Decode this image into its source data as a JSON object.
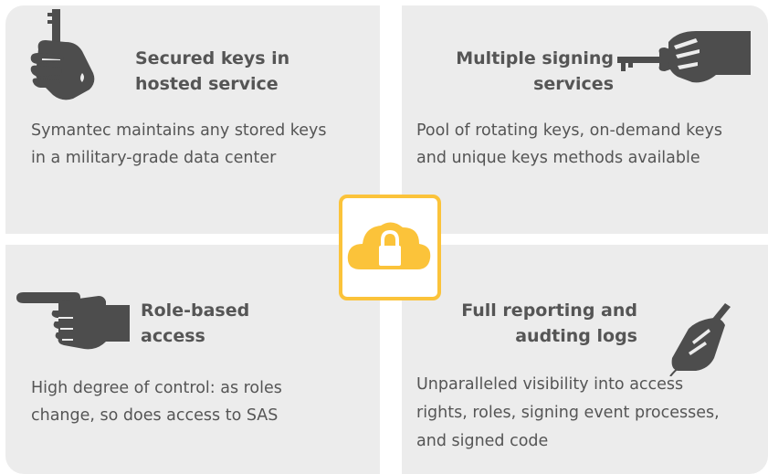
{
  "features": {
    "secured_keys": {
      "title_line1": "Secured keys in",
      "title_line2": "hosted service",
      "desc_line1": "Symantec maintains any stored keys",
      "desc_line2": "in a military-grade data center",
      "icon": "hand-holding-key-icon"
    },
    "signing_services": {
      "title_line1": "Multiple signing",
      "title_line2": "services",
      "desc_line1": "Pool of rotating keys, on-demand keys",
      "desc_line2": "and unique keys methods available",
      "icon": "hand-holding-key-horizontal-icon"
    },
    "role_access": {
      "title_line1": "Role-based",
      "title_line2": "access",
      "desc_line1": "High degree of control: as roles",
      "desc_line2": "change, so does access to SAS",
      "icon": "pointing-hand-icon"
    },
    "reporting_logs": {
      "title_line1": "Full reporting and",
      "title_line2": "audting logs",
      "desc_line1": "Unparalleled visibility into access",
      "desc_line2": "rights, roles, signing event processes,",
      "desc_line3": "and signed code",
      "icon": "hand-writing-pen-icon"
    }
  },
  "center_badge": {
    "icon": "cloud-lock-icon"
  },
  "colors": {
    "panel": "#ececec",
    "text": "#555555",
    "icon": "#4d4d4d",
    "accent_yellow": "#fbc33a"
  }
}
